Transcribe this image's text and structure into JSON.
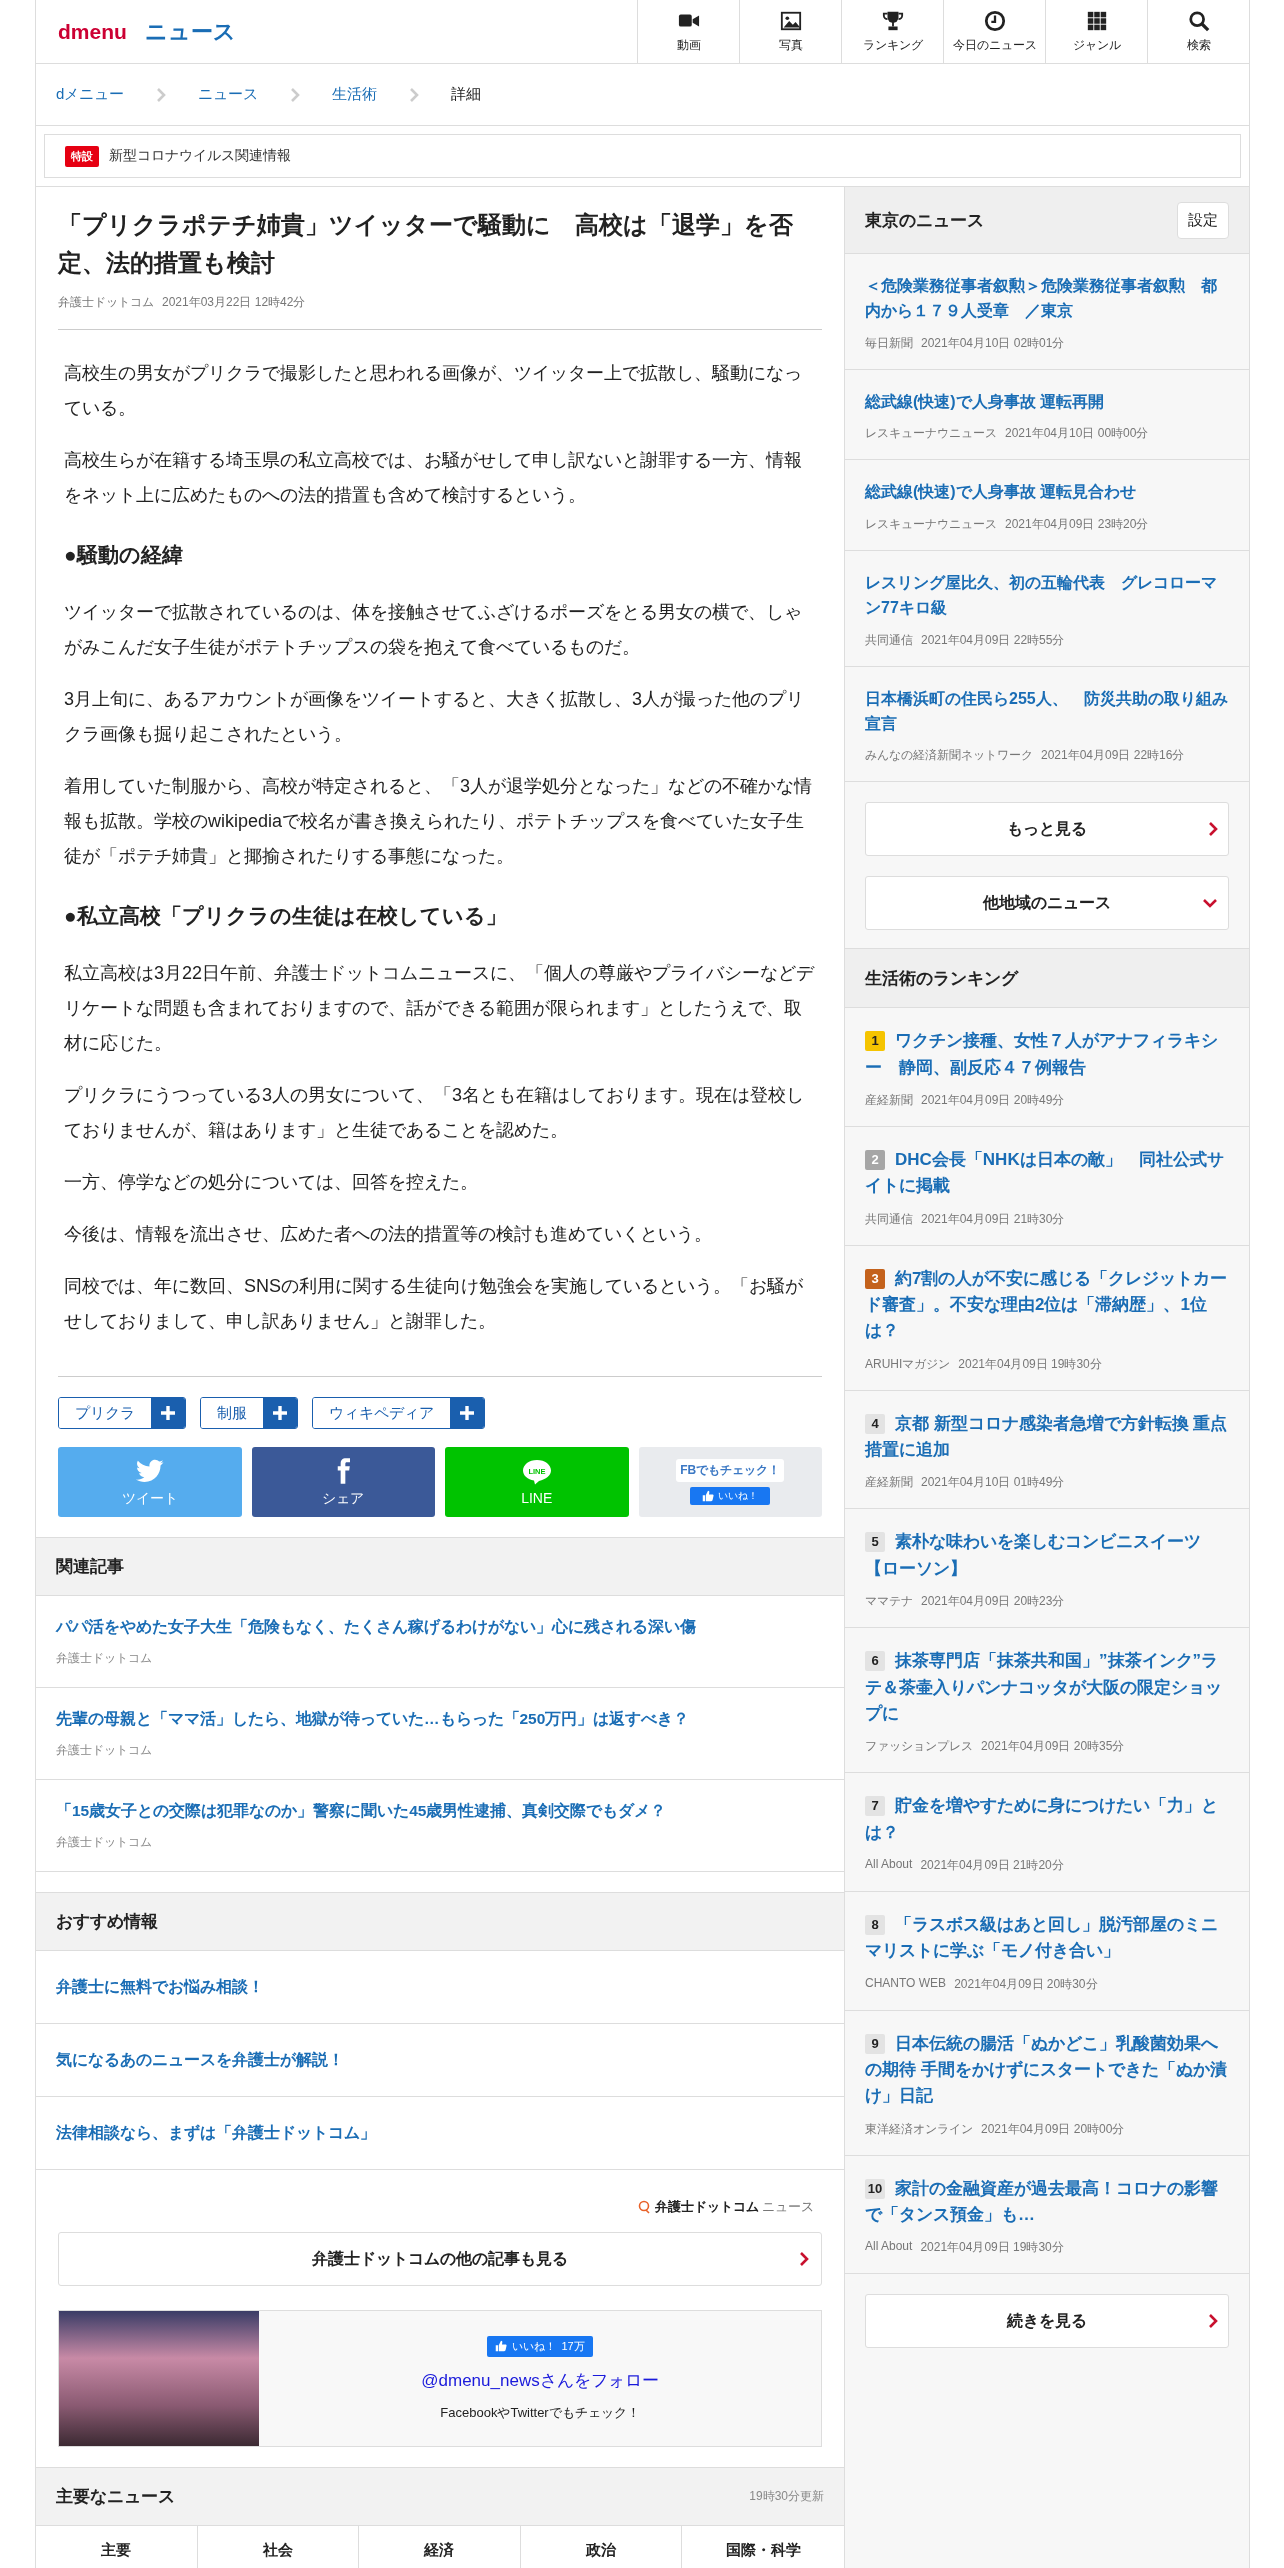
{
  "header": {
    "logo": "dmenu",
    "section": "ニュース",
    "nav": [
      {
        "label": "動画"
      },
      {
        "label": "写真"
      },
      {
        "label": "ランキング"
      },
      {
        "label": "今日のニュース"
      },
      {
        "label": "ジャンル"
      },
      {
        "label": "検索"
      }
    ]
  },
  "breadcrumb": [
    {
      "label": "dメニュー",
      "current": false
    },
    {
      "label": "ニュース",
      "current": false
    },
    {
      "label": "生活術",
      "current": false
    },
    {
      "label": "詳細",
      "current": true
    }
  ],
  "banner": {
    "badge": "特設",
    "text": "新型コロナウイルス関連情報"
  },
  "article": {
    "title": "「プリクラポテチ姉貴」ツイッターで騒動に　高校は「退学」を否定、法的措置も検討",
    "source": "弁護士ドットコム",
    "date": "2021年03月22日 12時42分",
    "body": [
      {
        "kind": "paragraph",
        "text": "高校生の男女がプリクラで撮影したと思われる画像が、ツイッター上で拡散し、騒動になっている。"
      },
      {
        "kind": "paragraph",
        "text": "高校生らが在籍する埼玉県の私立高校では、お騒がせして申し訳ないと謝罪する一方、情報をネット上に広めたものへの法的措置も含めて検討するという。"
      },
      {
        "kind": "heading",
        "text": "●騒動の経緯"
      },
      {
        "kind": "paragraph",
        "text": "ツイッターで拡散されているのは、体を接触させてふざけるポーズをとる男女の横で、しゃがみこんだ女子生徒がポテトチップスの袋を抱えて食べているものだ。"
      },
      {
        "kind": "paragraph",
        "text": "3月上旬に、あるアカウントが画像をツイートすると、大きく拡散し、3人が撮った他のプリクラ画像も掘り起こされたという。"
      },
      {
        "kind": "paragraph",
        "text": "着用していた制服から、高校が特定されると、「3人が退学処分となった」などの不確かな情報も拡散。学校のwikipediaで校名が書き換えられたり、ポテトチップスを食べていた女子生徒が「ポテチ姉貴」と揶揄されたりする事態になった。"
      },
      {
        "kind": "heading",
        "text": "●私立高校「プリクラの生徒は在校している」"
      },
      {
        "kind": "paragraph",
        "text": "私立高校は3月22日午前、弁護士ドットコムニュースに、「個人の尊厳やプライバシーなどデリケートな問題も含まれておりますので、話ができる範囲が限られます」としたうえで、取材に応じた。"
      },
      {
        "kind": "paragraph",
        "text": "プリクラにうつっている3人の男女について、「3名とも在籍はしております。現在は登校しておりませんが、籍はあります」と生徒であることを認めた。"
      },
      {
        "kind": "paragraph",
        "text": "一方、停学などの処分については、回答を控えた。"
      },
      {
        "kind": "paragraph",
        "text": "今後は、情報を流出させ、広めた者への法的措置等の検討も進めていくという。"
      },
      {
        "kind": "paragraph",
        "text": "同校では、年に数回、SNSの利用に関する生徒向け勉強会を実施しているという。「お騒がせしておりまして、申し訳ありません」と謝罪した。"
      }
    ],
    "tags": [
      "プリクラ",
      "制服",
      "ウィキペディア"
    ],
    "share": [
      {
        "kind": "twitter",
        "label": "ツイート"
      },
      {
        "kind": "facebook",
        "label": "シェア"
      },
      {
        "kind": "line",
        "label": "LINE",
        "logo_text": "LINE"
      },
      {
        "kind": "fb-like",
        "label": "FBでもチェック！",
        "button": "いいね！"
      }
    ]
  },
  "related": {
    "title": "関連記事",
    "items": [
      {
        "title": "パパ活をやめた女子大生「危険もなく、たくさん稼げるわけがない」心に残される深い傷",
        "source": "弁護士ドットコム"
      },
      {
        "title": "先輩の母親と「ママ活」したら、地獄が待っていた…もらった「250万円」は返すべき？",
        "source": "弁護士ドットコム"
      },
      {
        "title": "「15歳女子との交際は犯罪なのか」警察に聞いた45歳男性逮捕、真剣交際でもダメ？",
        "source": "弁護士ドットコム"
      }
    ]
  },
  "recommended": {
    "title": "おすすめ情報",
    "items": [
      {
        "title": "弁護士に無料でお悩み相談！"
      },
      {
        "title": "気になるあのニュースを弁護士が解説！"
      },
      {
        "title": "法律相談なら、まずは「弁護士ドットコム」"
      }
    ]
  },
  "provider": {
    "logo_name": "弁護士ドットコム",
    "logo_suffix": "ニュース",
    "more": "弁護士ドットコムの他の記事も見る"
  },
  "follow": {
    "like_label": "いいね！",
    "like_count": "17万",
    "link": "@dmenu_newsさんをフォロー",
    "note": "FacebookやTwitterでもチェック！"
  },
  "major_news": {
    "title": "主要なニュース",
    "updated": "19時30分更新",
    "tabs": [
      {
        "label": "主要",
        "selected": false
      },
      {
        "label": "社会",
        "selected": false
      },
      {
        "label": "経済",
        "selected": false
      },
      {
        "label": "政治",
        "selected": false
      },
      {
        "label": "国際・科学",
        "selected": false
      }
    ]
  },
  "tokyo_news": {
    "title": "東京のニュース",
    "settings": "設定",
    "items": [
      {
        "title": "＜危険業務従事者叙勲＞危険業務従事者叙勲　都内から１７９人受章　／東京",
        "source": "毎日新聞",
        "date": "2021年04月10日 02時01分"
      },
      {
        "title": "総武線(快速)で人身事故 運転再開",
        "source": "レスキューナウニュース",
        "date": "2021年04月10日 00時00分"
      },
      {
        "title": "総武線(快速)で人身事故 運転見合わせ",
        "source": "レスキューナウニュース",
        "date": "2021年04月09日 23時20分"
      },
      {
        "title": "レスリング屋比久、初の五輪代表　グレコローマン77キロ級",
        "source": "共同通信",
        "date": "2021年04月09日 22時55分"
      },
      {
        "title": "日本橋浜町の住民ら255人、　防災共助の取り組み宣言",
        "source": "みんなの経済新聞ネットワーク",
        "date": "2021年04月09日 22時16分"
      }
    ],
    "more": "もっと見る",
    "other_regions": "他地域のニュース"
  },
  "ranking": {
    "title": "生活術のランキング",
    "items": [
      {
        "rank": "1",
        "color": "#f5c400",
        "title": "ワクチン接種、女性７人がアナフィラキシー　静岡、副反応４７例報告",
        "source": "産経新聞",
        "date": "2021年04月09日 20時49分"
      },
      {
        "rank": "2",
        "color": "#a6a6a6",
        "title": "DHC会長「NHKは日本の敵」　同社公式サイトに掲載",
        "source": "共同通信",
        "date": "2021年04月09日 21時30分"
      },
      {
        "rank": "3",
        "color": "#c4621c",
        "title": "約7割の人が不安に感じる「クレジットカード審査」。不安な理由2位は「滞納歴」、1位は？",
        "source": "ARUHIマガジン",
        "date": "2021年04月09日 19時30分"
      },
      {
        "rank": "4",
        "color": "#e3e3e3",
        "title": "京都 新型コロナ感染者急増で方針転換 重点措置に追加",
        "source": "産経新聞",
        "date": "2021年04月10日 01時49分"
      },
      {
        "rank": "5",
        "color": "#e3e3e3",
        "title": "素朴な味わいを楽しむコンビニスイーツ【ローソン】",
        "source": "ママテナ",
        "date": "2021年04月09日 20時23分"
      },
      {
        "rank": "6",
        "color": "#e3e3e3",
        "title": "抹茶専門店「抹茶共和国」”抹茶インク”ラテ＆茶壷入りパンナコッタが大阪の限定ショップに",
        "source": "ファッションプレス",
        "date": "2021年04月09日 20時35分"
      },
      {
        "rank": "7",
        "color": "#e3e3e3",
        "title": "貯金を増やすために身につけたい「力」とは？",
        "source": "All About",
        "date": "2021年04月09日 21時20分"
      },
      {
        "rank": "8",
        "color": "#e3e3e3",
        "title": "「ラスボス級はあと回し」脱汚部屋のミニマリストに学ぶ「モノ付き合い」",
        "source": "CHANTO WEB",
        "date": "2021年04月09日 20時30分"
      },
      {
        "rank": "9",
        "color": "#e3e3e3",
        "title": "日本伝統の腸活「ぬかどこ」乳酸菌効果への期待 手間をかけずにスタートできた「ぬか漬け」日記",
        "source": "東洋経済オンライン",
        "date": "2021年04月09日 20時00分"
      },
      {
        "rank": "10",
        "color": "#e3e3e3",
        "title": "家計の金融資産が過去最高！コロナの影響で「タンス預金」も…",
        "source": "All About",
        "date": "2021年04月09日 19時30分"
      }
    ],
    "more": "続きを見る"
  }
}
